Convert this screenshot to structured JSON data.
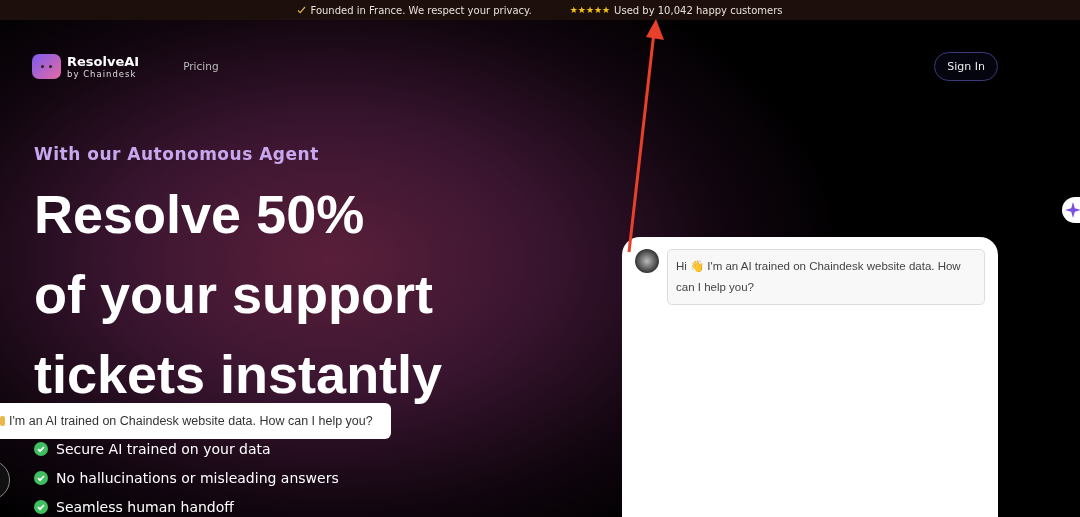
{
  "top_bar": {
    "privacy_note": "Founded in France. We respect your privacy.",
    "stars": 5,
    "customers": "Used by 10,042 happy customers"
  },
  "nav": {
    "brand": "ResolveAI",
    "brand_sub": "by Chaindesk",
    "links": [
      "Pricing"
    ],
    "sign_in": "Sign In"
  },
  "hero": {
    "eyebrow": "With our Autonomous Agent",
    "headline": [
      "Resolve 50%",
      "of your support",
      "tickets instantly"
    ],
    "features": [
      "Secure AI trained on your data",
      "No hallucinations or misleading answers",
      "Seamless human handoff"
    ]
  },
  "chat": {
    "message": "Hi 👋 I'm an AI trained on Chaindesk website data. How can I help you?"
  },
  "popup": {
    "message": "I'm an AI trained on Chaindesk website data. How can I help you?"
  }
}
